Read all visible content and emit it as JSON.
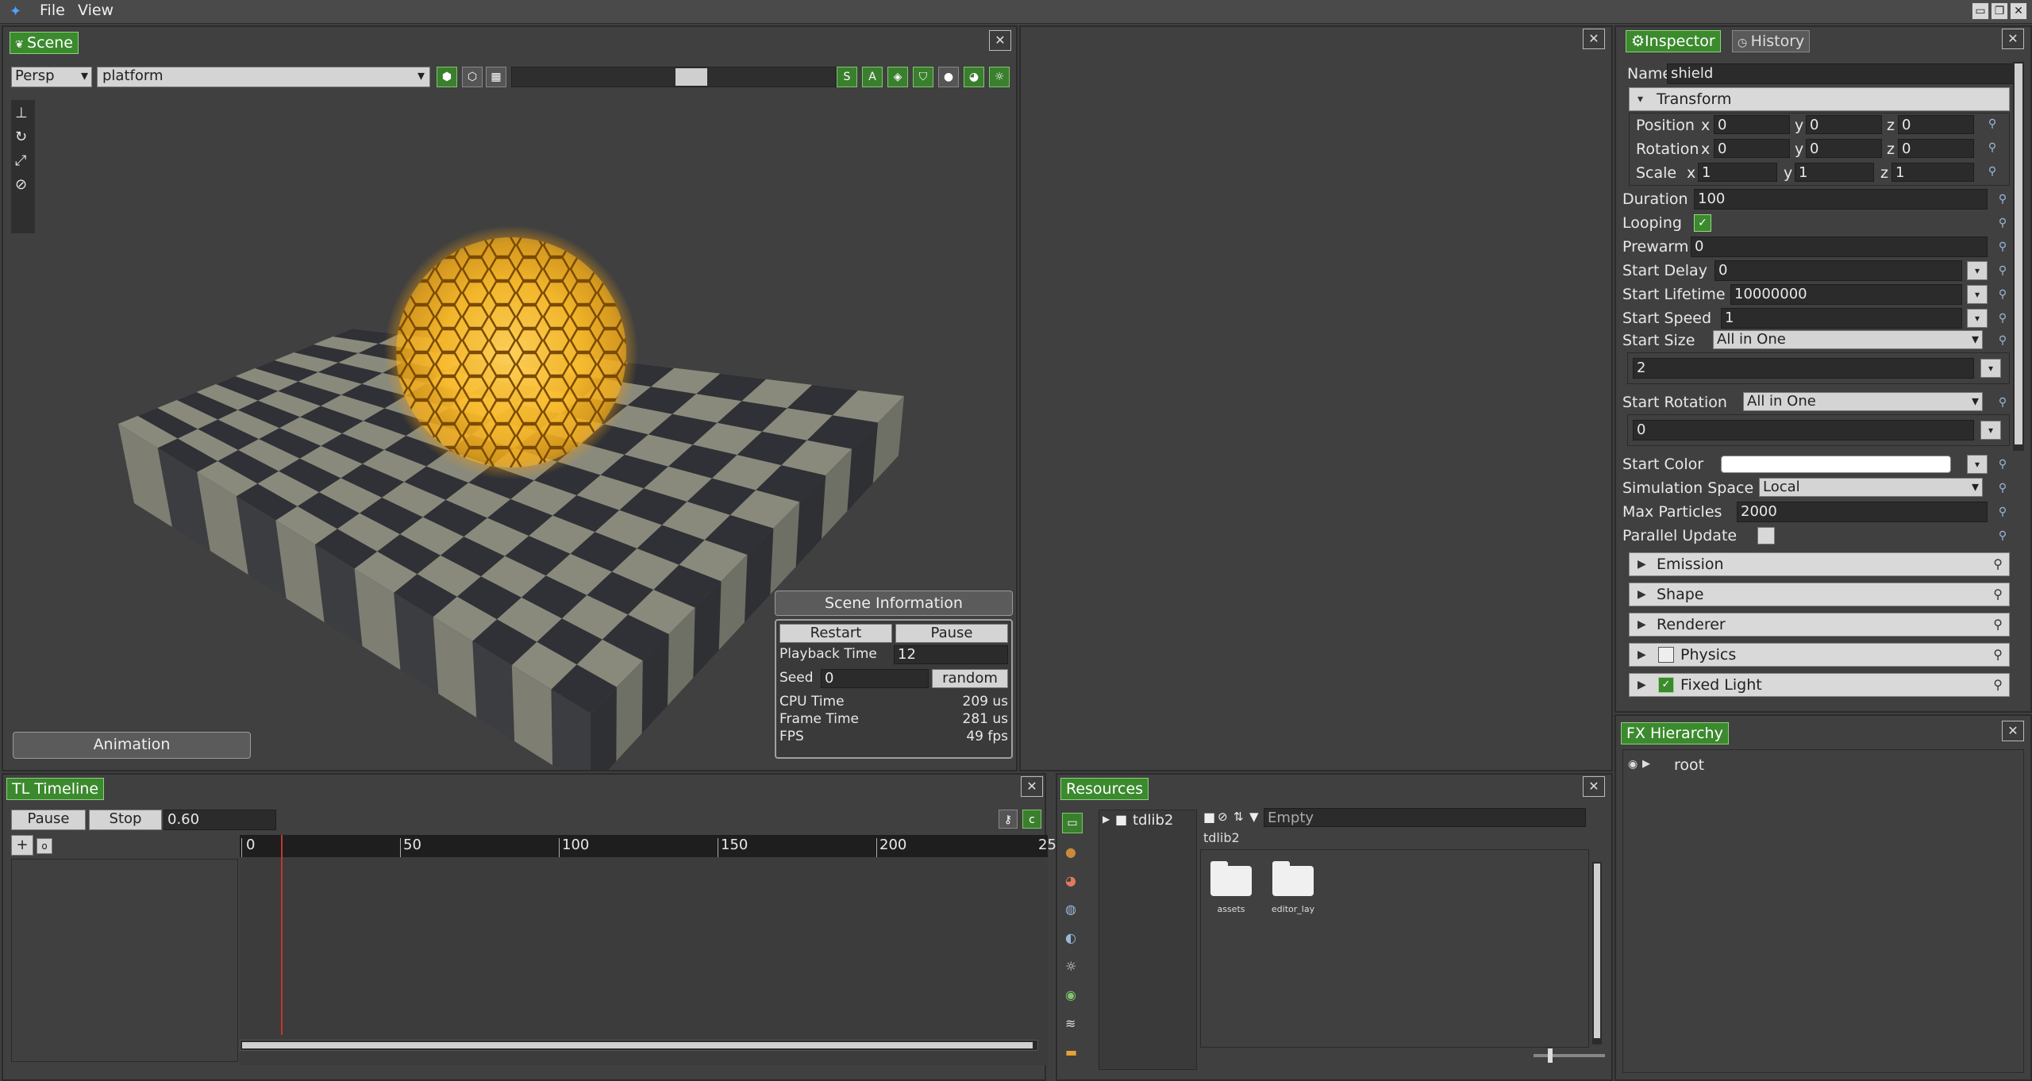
{
  "menu": {
    "items": [
      "File",
      "View"
    ]
  },
  "window_controls": [
    "▭",
    "❐",
    "✕"
  ],
  "scene": {
    "tab": "Scene",
    "projection": "Persp",
    "scene_name": "platform",
    "tool_buttons": [
      "S",
      "A"
    ],
    "animation_button": "Animation",
    "info": {
      "title": "Scene Information",
      "restart": "Restart",
      "pause": "Pause",
      "playback_label": "Playback Time",
      "playback_value": "12",
      "seed_label": "Seed",
      "seed_value": "0",
      "random": "random",
      "cpu_label": "CPU Time",
      "cpu_value": "209 us",
      "frame_label": "Frame Time",
      "frame_value": "281 us",
      "fps_label": "FPS",
      "fps_value": "49 fps"
    }
  },
  "inspector": {
    "tab_inspector": "Inspector",
    "tab_history": "History",
    "name_label": "Name",
    "name_value": "shield",
    "transform_title": "Transform",
    "position_label": "Position",
    "rotation_label": "Rotation",
    "scale_label": "Scale",
    "axis": {
      "x": "x",
      "y": "y",
      "z": "z"
    },
    "position": {
      "x": "0",
      "y": "0",
      "z": "0"
    },
    "rotation": {
      "x": "0",
      "y": "0",
      "z": "0"
    },
    "scale": {
      "x": "1",
      "y": "1",
      "z": "1"
    },
    "duration_label": "Duration",
    "duration_value": "100",
    "looping_label": "Looping",
    "prewarm_label": "Prewarm",
    "prewarm_value": "0",
    "start_delay_label": "Start Delay",
    "start_delay_value": "0",
    "start_lifetime_label": "Start Lifetime",
    "start_lifetime_value": "10000000",
    "start_speed_label": "Start Speed",
    "start_speed_value": "1",
    "start_size_label": "Start Size",
    "start_size_mode": "All in One",
    "start_size_value": "2",
    "start_rotation_label": "Start Rotation",
    "start_rotation_mode": "All in One",
    "start_rotation_value": "0",
    "start_color_label": "Start Color",
    "simulation_space_label": "Simulation Space",
    "simulation_space_value": "Local",
    "max_particles_label": "Max Particles",
    "max_particles_value": "2000",
    "parallel_update_label": "Parallel Update",
    "sections": [
      "Emission",
      "Shape",
      "Renderer",
      "Physics",
      "Fixed Light"
    ]
  },
  "fx_hierarchy": {
    "tab": "FX Hierarchy",
    "root": "root"
  },
  "timeline": {
    "tab": "TL Timeline",
    "pause": "Pause",
    "stop": "Stop",
    "time_value": "0.60",
    "ticks": [
      "0",
      "50",
      "100",
      "150",
      "200",
      "25"
    ]
  },
  "resources": {
    "tab": "Resources",
    "tree_root": "tdlib2",
    "filter_placeholder": "Empty",
    "path": "tdlib2",
    "folders": [
      "assets",
      "editor_lay"
    ]
  },
  "colors": {
    "accent_green": "#3b8a2e",
    "panel": "#404040",
    "playhead": "#c0392b",
    "glow": "#ffc83a"
  }
}
